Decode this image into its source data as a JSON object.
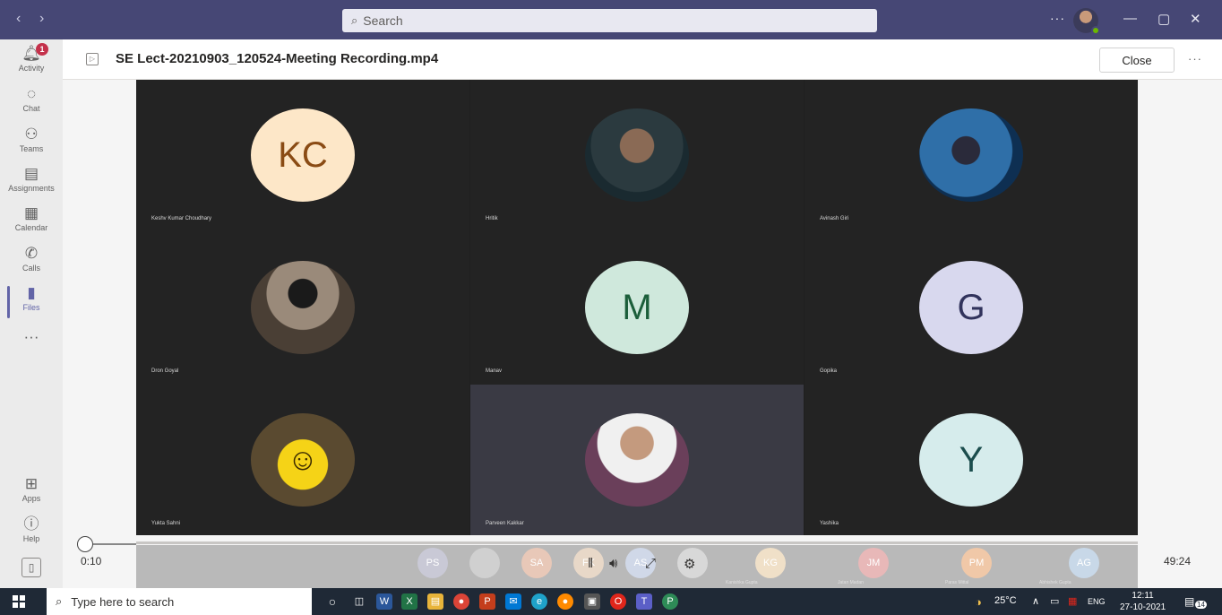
{
  "titlebar": {
    "back_icon": "chevron-left-icon",
    "forward_icon": "chevron-right-icon",
    "search_placeholder": "Search",
    "more": "···"
  },
  "rail": {
    "items": [
      {
        "label": "Activity",
        "icon": "bell-icon",
        "badge": "1"
      },
      {
        "label": "Chat",
        "icon": "chat-icon"
      },
      {
        "label": "Teams",
        "icon": "teams-icon"
      },
      {
        "label": "Assignments",
        "icon": "backpack-icon"
      },
      {
        "label": "Calendar",
        "icon": "calendar-icon"
      },
      {
        "label": "Calls",
        "icon": "phone-icon"
      },
      {
        "label": "Files",
        "icon": "file-icon",
        "active": true
      },
      {
        "label": "Apps",
        "icon": "apps-icon"
      },
      {
        "label": "Help",
        "icon": "help-icon"
      }
    ],
    "more": "···"
  },
  "header": {
    "title": "SE Lect-20210903_120524-Meeting Recording.mp4",
    "close_label": "Close",
    "more": "···"
  },
  "participants": [
    {
      "name": "Keshv Kumar Choudhary",
      "initials": "KC",
      "avatar_color": "#fde7c8",
      "text_color": "#8a4b14"
    },
    {
      "name": "Hritik",
      "initials": "",
      "avatar_color": "#2b3a3f"
    },
    {
      "name": "Avinash Giri",
      "initials": "",
      "avatar_color": "#1d4a7a"
    },
    {
      "name": "Dron Goyal",
      "initials": "",
      "avatar_color": "#6d5a4a"
    },
    {
      "name": "Manav",
      "initials": "M",
      "avatar_color": "#cfe8dc",
      "text_color": "#1b5e3a"
    },
    {
      "name": "Gopika",
      "initials": "G",
      "avatar_color": "#d8d8ee",
      "text_color": "#31335c"
    },
    {
      "name": "Yukta Sahni",
      "initials": "",
      "avatar_color": "#c7a24a"
    },
    {
      "name": "Parveen Kakkar",
      "initials": "",
      "avatar_color": "#e8e8e8",
      "highlight": true
    },
    {
      "name": "Yashika",
      "initials": "Y",
      "avatar_color": "#d6ecec",
      "text_color": "#1b4d4d"
    }
  ],
  "player": {
    "current_time": "0:10",
    "total_time": "49:24",
    "progress": 0.0034
  },
  "strip": {
    "chips": [
      {
        "initials": "PS",
        "color": "#c9c9d6"
      },
      {
        "initials": "",
        "color": "#d0d0d0"
      },
      {
        "initials": "SA",
        "color": "#e8c8b8"
      },
      {
        "initials": "FK",
        "color": "#e8d8c8"
      },
      {
        "initials": "AS",
        "color": "#d0d8e8"
      },
      {
        "initials": "",
        "color": "#d8d8d8"
      },
      {
        "initials": "KG",
        "color": "#f0e0c8",
        "name": "Kanishka Gupta"
      },
      {
        "initials": "JM",
        "color": "#e8b8b8",
        "name": "Jatan Madan"
      },
      {
        "initials": "PM",
        "color": "#f0c8a8",
        "name": "Paras Mittal"
      },
      {
        "initials": "AG",
        "color": "#c8d8e8",
        "name": "Abhishek Gupta"
      }
    ]
  },
  "taskbar": {
    "search_placeholder": "Type here to search",
    "weather": "25°C",
    "lang": "ENG",
    "time": "12:11",
    "date": "27-10-2021",
    "notifications": "14"
  }
}
